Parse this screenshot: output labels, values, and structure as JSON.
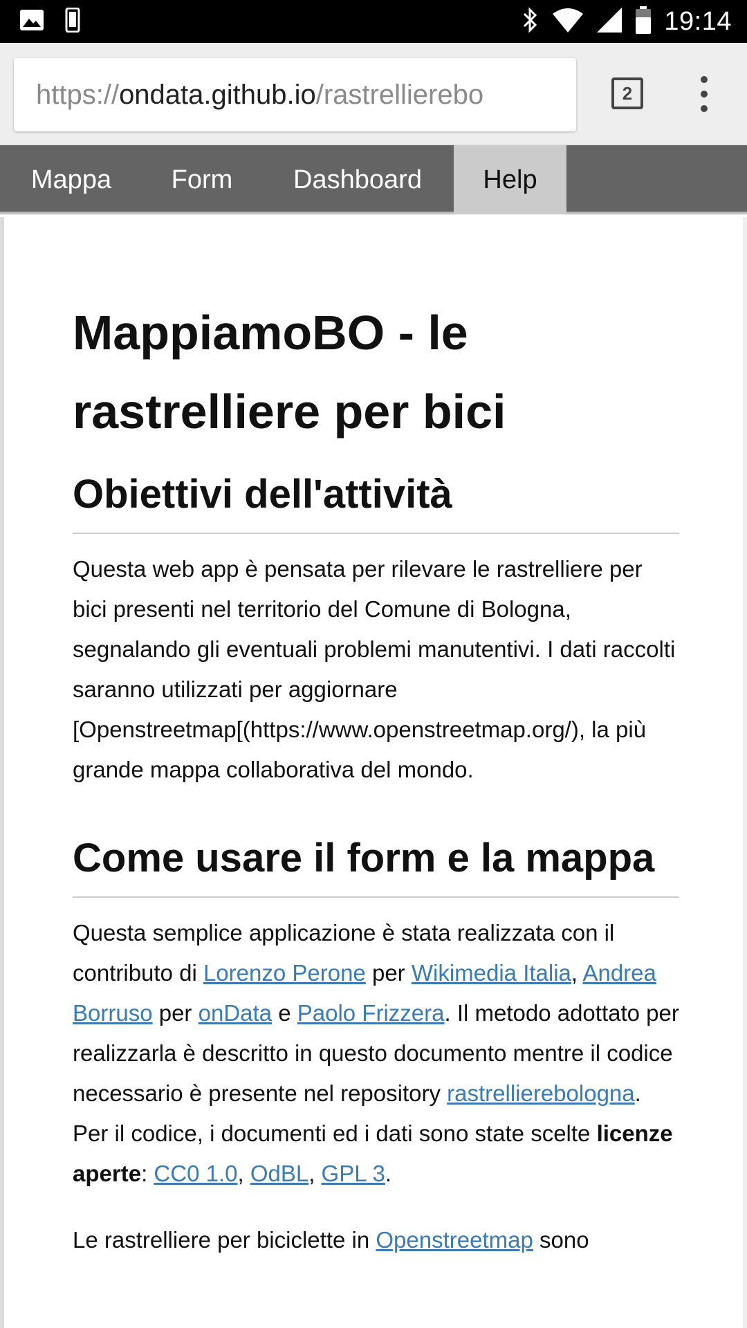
{
  "status_bar": {
    "time": "19:14",
    "left_icons": [
      "gallery-notification-icon",
      "phone-notification-icon"
    ],
    "right_icons": [
      "bluetooth-icon",
      "wifi-icon",
      "cell-signal-icon",
      "battery-icon"
    ]
  },
  "browser": {
    "url_scheme": "https://",
    "url_host": "ondata.github.io",
    "url_path": "/rastrellierebo",
    "tab_count": "2"
  },
  "nav": {
    "items": [
      {
        "label": "Mappa",
        "active": false
      },
      {
        "label": "Form",
        "active": false
      },
      {
        "label": "Dashboard",
        "active": false
      },
      {
        "label": "Help",
        "active": true
      }
    ]
  },
  "article": {
    "title_line1": "MappiamoBO - le",
    "title_line2": "rastrelliere per bici",
    "section1": {
      "heading": "Obiettivi dell'attività",
      "text": "Questa web app è pensata per rilevare le rastrelliere per bici presenti nel territorio del Comune di Bologna, segnalando gli eventuali problemi manutentivi. I dati raccolti saranno utilizzati per aggiornare [Openstreetmap[(https://www.openstreetmap.org/), la più grande mappa collaborativa del mondo."
    },
    "section2": {
      "heading": "Come usare il form e la mappa",
      "p1_text1": "Questa semplice applicazione è stata realizzata con il contributo di ",
      "link_lorenzo": "Lorenzo Perone",
      "p1_text2": " per ",
      "link_wikimedia": "Wikimedia Italia",
      "p1_text3": ", ",
      "link_andrea": "Andrea Borruso",
      "p1_text4": " per ",
      "link_ondata": "onData",
      "p1_text5": " e ",
      "link_paolo": "Paolo Frizzera",
      "p1_text6": ". Il metodo adottato per realizzarla è descritto in questo documento mentre il codice necessario è presente nel repository ",
      "link_repo": "rastrellierebologna",
      "p1_text7": ". Per il codice, i documenti ed i dati sono state scelte ",
      "bold_licenses": "licenze aperte",
      "p1_text8": ": ",
      "link_cc0": "CC0 1.0",
      "sep1": ", ",
      "link_odbl": "OdBL",
      "sep2": ", ",
      "link_gpl": "GPL 3",
      "p1_end": ".",
      "p2_text1": "Le rastrelliere per biciclette in ",
      "link_osm": "Openstreetmap",
      "p2_text2": " sono"
    }
  }
}
